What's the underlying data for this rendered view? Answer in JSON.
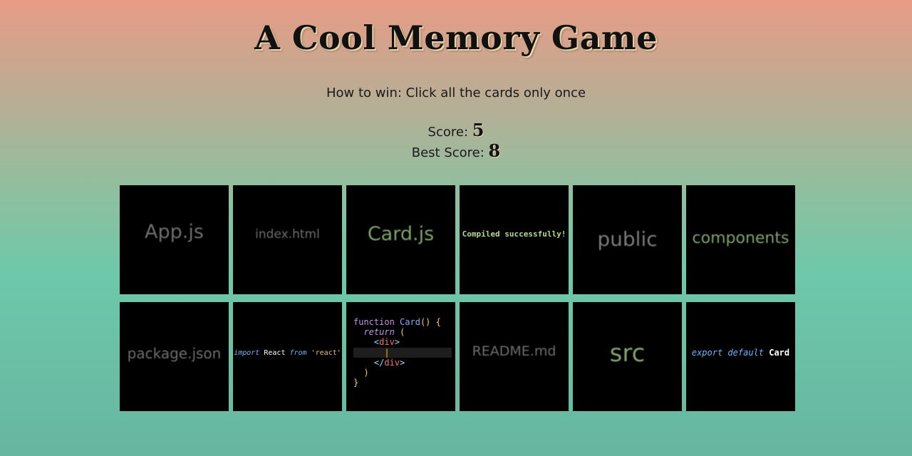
{
  "header": {
    "title": "A Cool Memory Game",
    "instructions": "How to win: Click all the cards only once"
  },
  "scoreboard": {
    "score_label": "Score:",
    "score": "5",
    "best_label": "Best Score:",
    "best": "8"
  },
  "cards": [
    {
      "label": "App.js"
    },
    {
      "label": "index.html"
    },
    {
      "label": "Card.js"
    },
    {
      "label": "Compiled successfully!"
    },
    {
      "label": "public"
    },
    {
      "label": "components"
    },
    {
      "label": "package.json"
    },
    {
      "import_kw": "import",
      "import_name": "React",
      "from_kw": "from",
      "module": "'react'"
    },
    {
      "code_lines": [
        "function",
        "Card",
        "()",
        "{",
        "return",
        "(",
        "<",
        "div",
        ">",
        "</",
        "div",
        ">",
        ")",
        "}"
      ]
    },
    {
      "label": "README.md"
    },
    {
      "label": "src"
    },
    {
      "export_kw": "export default",
      "export_name": "Card"
    }
  ],
  "colors": {
    "card_background": "#000000",
    "gradient_top": "#e89c86",
    "gradient_bottom": "#67b6a0"
  }
}
